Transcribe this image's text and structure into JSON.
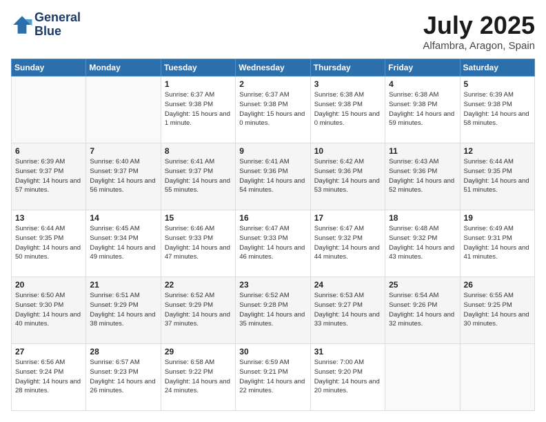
{
  "header": {
    "logo_line1": "General",
    "logo_line2": "Blue",
    "month_year": "July 2025",
    "location": "Alfambra, Aragon, Spain"
  },
  "weekdays": [
    "Sunday",
    "Monday",
    "Tuesday",
    "Wednesday",
    "Thursday",
    "Friday",
    "Saturday"
  ],
  "weeks": [
    [
      {
        "day": "",
        "sunrise": "",
        "sunset": "",
        "daylight": ""
      },
      {
        "day": "",
        "sunrise": "",
        "sunset": "",
        "daylight": ""
      },
      {
        "day": "1",
        "sunrise": "Sunrise: 6:37 AM",
        "sunset": "Sunset: 9:38 PM",
        "daylight": "Daylight: 15 hours and 1 minute."
      },
      {
        "day": "2",
        "sunrise": "Sunrise: 6:37 AM",
        "sunset": "Sunset: 9:38 PM",
        "daylight": "Daylight: 15 hours and 0 minutes."
      },
      {
        "day": "3",
        "sunrise": "Sunrise: 6:38 AM",
        "sunset": "Sunset: 9:38 PM",
        "daylight": "Daylight: 15 hours and 0 minutes."
      },
      {
        "day": "4",
        "sunrise": "Sunrise: 6:38 AM",
        "sunset": "Sunset: 9:38 PM",
        "daylight": "Daylight: 14 hours and 59 minutes."
      },
      {
        "day": "5",
        "sunrise": "Sunrise: 6:39 AM",
        "sunset": "Sunset: 9:38 PM",
        "daylight": "Daylight: 14 hours and 58 minutes."
      }
    ],
    [
      {
        "day": "6",
        "sunrise": "Sunrise: 6:39 AM",
        "sunset": "Sunset: 9:37 PM",
        "daylight": "Daylight: 14 hours and 57 minutes."
      },
      {
        "day": "7",
        "sunrise": "Sunrise: 6:40 AM",
        "sunset": "Sunset: 9:37 PM",
        "daylight": "Daylight: 14 hours and 56 minutes."
      },
      {
        "day": "8",
        "sunrise": "Sunrise: 6:41 AM",
        "sunset": "Sunset: 9:37 PM",
        "daylight": "Daylight: 14 hours and 55 minutes."
      },
      {
        "day": "9",
        "sunrise": "Sunrise: 6:41 AM",
        "sunset": "Sunset: 9:36 PM",
        "daylight": "Daylight: 14 hours and 54 minutes."
      },
      {
        "day": "10",
        "sunrise": "Sunrise: 6:42 AM",
        "sunset": "Sunset: 9:36 PM",
        "daylight": "Daylight: 14 hours and 53 minutes."
      },
      {
        "day": "11",
        "sunrise": "Sunrise: 6:43 AM",
        "sunset": "Sunset: 9:36 PM",
        "daylight": "Daylight: 14 hours and 52 minutes."
      },
      {
        "day": "12",
        "sunrise": "Sunrise: 6:44 AM",
        "sunset": "Sunset: 9:35 PM",
        "daylight": "Daylight: 14 hours and 51 minutes."
      }
    ],
    [
      {
        "day": "13",
        "sunrise": "Sunrise: 6:44 AM",
        "sunset": "Sunset: 9:35 PM",
        "daylight": "Daylight: 14 hours and 50 minutes."
      },
      {
        "day": "14",
        "sunrise": "Sunrise: 6:45 AM",
        "sunset": "Sunset: 9:34 PM",
        "daylight": "Daylight: 14 hours and 49 minutes."
      },
      {
        "day": "15",
        "sunrise": "Sunrise: 6:46 AM",
        "sunset": "Sunset: 9:33 PM",
        "daylight": "Daylight: 14 hours and 47 minutes."
      },
      {
        "day": "16",
        "sunrise": "Sunrise: 6:47 AM",
        "sunset": "Sunset: 9:33 PM",
        "daylight": "Daylight: 14 hours and 46 minutes."
      },
      {
        "day": "17",
        "sunrise": "Sunrise: 6:47 AM",
        "sunset": "Sunset: 9:32 PM",
        "daylight": "Daylight: 14 hours and 44 minutes."
      },
      {
        "day": "18",
        "sunrise": "Sunrise: 6:48 AM",
        "sunset": "Sunset: 9:32 PM",
        "daylight": "Daylight: 14 hours and 43 minutes."
      },
      {
        "day": "19",
        "sunrise": "Sunrise: 6:49 AM",
        "sunset": "Sunset: 9:31 PM",
        "daylight": "Daylight: 14 hours and 41 minutes."
      }
    ],
    [
      {
        "day": "20",
        "sunrise": "Sunrise: 6:50 AM",
        "sunset": "Sunset: 9:30 PM",
        "daylight": "Daylight: 14 hours and 40 minutes."
      },
      {
        "day": "21",
        "sunrise": "Sunrise: 6:51 AM",
        "sunset": "Sunset: 9:29 PM",
        "daylight": "Daylight: 14 hours and 38 minutes."
      },
      {
        "day": "22",
        "sunrise": "Sunrise: 6:52 AM",
        "sunset": "Sunset: 9:29 PM",
        "daylight": "Daylight: 14 hours and 37 minutes."
      },
      {
        "day": "23",
        "sunrise": "Sunrise: 6:52 AM",
        "sunset": "Sunset: 9:28 PM",
        "daylight": "Daylight: 14 hours and 35 minutes."
      },
      {
        "day": "24",
        "sunrise": "Sunrise: 6:53 AM",
        "sunset": "Sunset: 9:27 PM",
        "daylight": "Daylight: 14 hours and 33 minutes."
      },
      {
        "day": "25",
        "sunrise": "Sunrise: 6:54 AM",
        "sunset": "Sunset: 9:26 PM",
        "daylight": "Daylight: 14 hours and 32 minutes."
      },
      {
        "day": "26",
        "sunrise": "Sunrise: 6:55 AM",
        "sunset": "Sunset: 9:25 PM",
        "daylight": "Daylight: 14 hours and 30 minutes."
      }
    ],
    [
      {
        "day": "27",
        "sunrise": "Sunrise: 6:56 AM",
        "sunset": "Sunset: 9:24 PM",
        "daylight": "Daylight: 14 hours and 28 minutes."
      },
      {
        "day": "28",
        "sunrise": "Sunrise: 6:57 AM",
        "sunset": "Sunset: 9:23 PM",
        "daylight": "Daylight: 14 hours and 26 minutes."
      },
      {
        "day": "29",
        "sunrise": "Sunrise: 6:58 AM",
        "sunset": "Sunset: 9:22 PM",
        "daylight": "Daylight: 14 hours and 24 minutes."
      },
      {
        "day": "30",
        "sunrise": "Sunrise: 6:59 AM",
        "sunset": "Sunset: 9:21 PM",
        "daylight": "Daylight: 14 hours and 22 minutes."
      },
      {
        "day": "31",
        "sunrise": "Sunrise: 7:00 AM",
        "sunset": "Sunset: 9:20 PM",
        "daylight": "Daylight: 14 hours and 20 minutes."
      },
      {
        "day": "",
        "sunrise": "",
        "sunset": "",
        "daylight": ""
      },
      {
        "day": "",
        "sunrise": "",
        "sunset": "",
        "daylight": ""
      }
    ]
  ]
}
